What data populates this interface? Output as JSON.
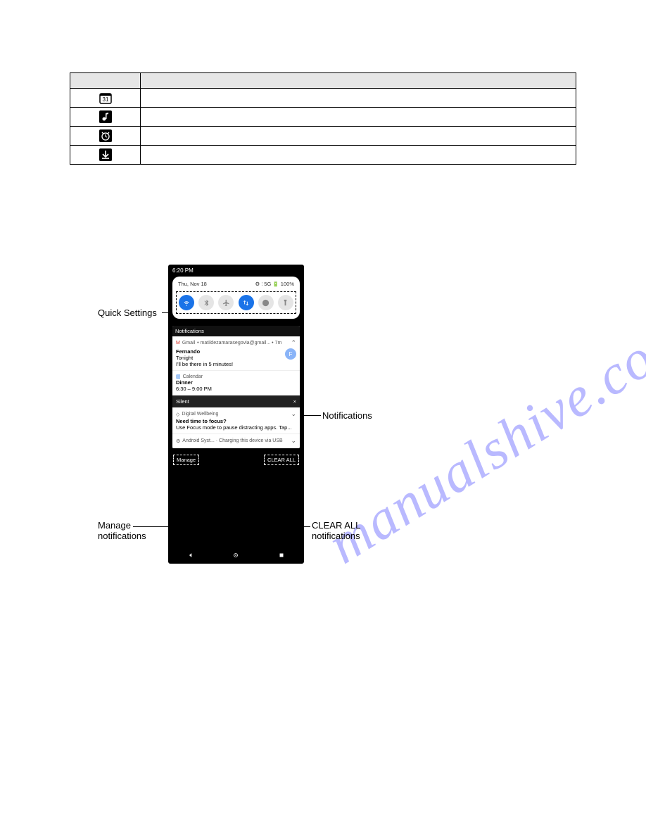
{
  "table": {
    "rows": [
      "calendar-31",
      "music-note",
      "alarm-clock",
      "download"
    ]
  },
  "watermark": "manualshive.com",
  "callouts": {
    "quick_settings": "Quick Settings",
    "notifications_label": "Notifications",
    "manage_line1": "Manage",
    "manage_line2": "notifications",
    "clearall_line1": "CLEAR ALL",
    "clearall_line2": "notifications"
  },
  "phone": {
    "time": "6:20 PM",
    "date": "Thu, Nov 18",
    "status_right": "⚙ ⫶ 5G 🔋 100%",
    "notif_title": "Notifications",
    "gmail": {
      "app": "Gmail",
      "sub": "• matildezamarasegovia@gmail... • 7m",
      "sender": "Fernando",
      "subj": "Tonight",
      "body": "I'll be there in 5 minutes!",
      "avatar": "F"
    },
    "calendar": {
      "app": "Calendar",
      "title": "Dinner",
      "time": "6:30 – 9:00 PM"
    },
    "silent": "Silent",
    "wellbeing": {
      "app": "Digital Wellbeing",
      "title": "Need time to focus?",
      "body": "Use Focus mode to pause distracting apps. Tap..."
    },
    "android_system": "Android Syst...  · Charging this device via USB",
    "manage_btn": "Manage",
    "clearall_btn": "CLEAR ALL"
  }
}
